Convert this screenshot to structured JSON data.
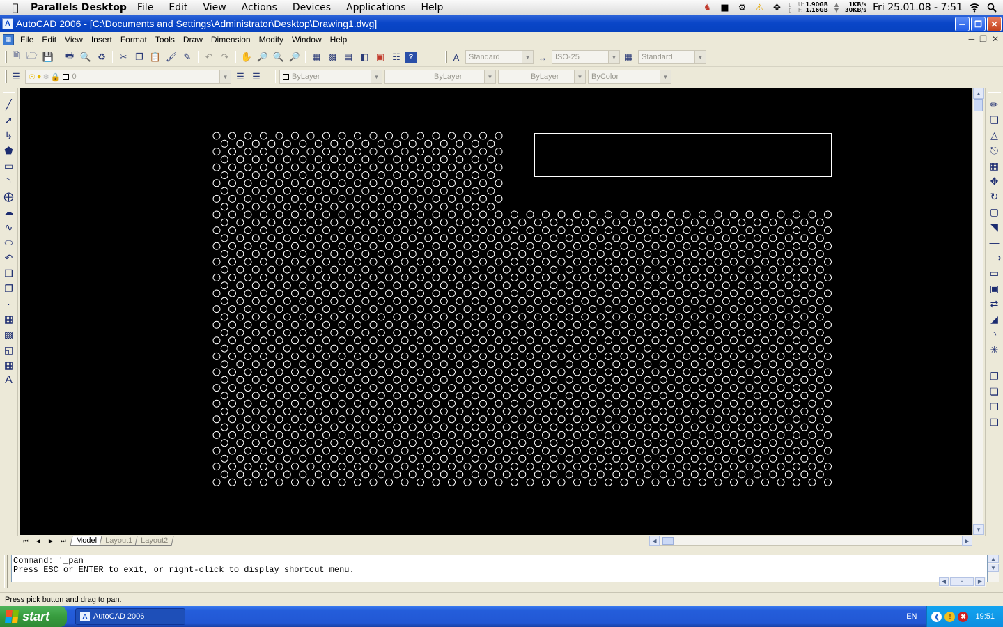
{
  "mac": {
    "app_name": "Parallels Desktop",
    "menu": [
      "File",
      "Edit",
      "View",
      "Actions",
      "Devices",
      "Applications",
      "Help"
    ],
    "mem_u_label": "U:",
    "mem_u": "1.90GB",
    "mem_f_label": "F:",
    "mem_f": "1.16GB",
    "net_up": "1KB/s",
    "net_down": "30KB/s",
    "clock": "Fri 25.01.08 - 7:51"
  },
  "window": {
    "title": "AutoCAD 2006 - [C:\\Documents and Settings\\Administrator\\Desktop\\Drawing1.dwg]",
    "app_icon": "A"
  },
  "menubar": [
    "File",
    "Edit",
    "View",
    "Insert",
    "Format",
    "Tools",
    "Draw",
    "Dimension",
    "Modify",
    "Window",
    "Help"
  ],
  "toolbar": {
    "text_style": "Standard",
    "dim_style": "ISO-25",
    "table_style": "Standard",
    "layer": "0",
    "color": "ByLayer",
    "linetype": "ByLayer",
    "lineweight": "ByLayer",
    "plotstyle": "ByColor"
  },
  "tabs": [
    "Model",
    "Layout1",
    "Layout2"
  ],
  "command": {
    "line1": "Command: '_pan",
    "line2": "Press ESC or ENTER to exit, or right-click to display shortcut menu."
  },
  "status": "Press pick button and drag to pan.",
  "taskbar": {
    "start": "start",
    "task": "AutoCAD 2006",
    "lang": "EN",
    "time": "19:51"
  },
  "colors": {
    "xp_blue": "#0a46c8",
    "canvas": "#000000",
    "drawing": "#ffffff",
    "start_green": "#379c3e"
  }
}
